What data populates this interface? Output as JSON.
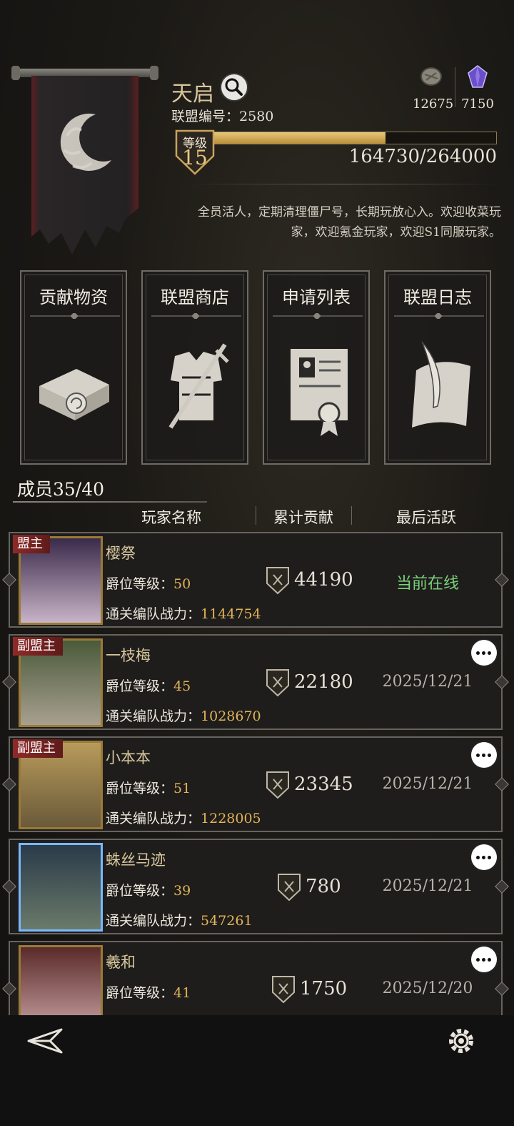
{
  "alliance": {
    "name": "天启",
    "id_label": "联盟编号：",
    "id": "2580",
    "description": "全员活人，定期清理僵尸号，长期玩放心入。欢迎收菜玩家，欢迎氪金玩家，欢迎S1同服玩家。"
  },
  "resources": [
    {
      "icon": "stone-coin-icon",
      "value": "12675"
    },
    {
      "icon": "purple-crystal-icon",
      "value": "7150"
    }
  ],
  "level": {
    "label": "等级",
    "value": "15",
    "xp_text": "164730/264000",
    "progress": 0.624
  },
  "features": [
    {
      "label": "贡献物资",
      "icon": "scroll-bundle-icon"
    },
    {
      "label": "联盟商店",
      "icon": "armor-sword-icon"
    },
    {
      "label": "申请列表",
      "icon": "certificate-icon"
    },
    {
      "label": "联盟日志",
      "icon": "quill-paper-icon"
    }
  ],
  "members": {
    "count_label": "成员35/40",
    "columns": [
      "玩家名称",
      "累计贡献",
      "最后活跃"
    ],
    "rank_label": "爵位等级：",
    "power_label": "通关编队战力：",
    "rows": [
      {
        "role": "盟主",
        "name": "樱祭",
        "rank": "50",
        "power": "1144754",
        "contribution": "44190",
        "last_active": "当前在线",
        "online": true
      },
      {
        "role": "副盟主",
        "name": "一枝梅",
        "rank": "45",
        "power": "1028670",
        "contribution": "22180",
        "last_active": "2025/12/21",
        "online": false
      },
      {
        "role": "副盟主",
        "name": "小本本",
        "rank": "51",
        "power": "1228005",
        "contribution": "23345",
        "last_active": "2025/12/21",
        "online": false
      },
      {
        "role": "",
        "name": "蛛丝马迹",
        "rank": "39",
        "power": "547261",
        "contribution": "780",
        "last_active": "2025/12/21",
        "online": false
      },
      {
        "role": "",
        "name": "羲和",
        "rank": "41",
        "power": "",
        "contribution": "1750",
        "last_active": "2025/12/20",
        "online": false
      }
    ]
  },
  "colors": {
    "gold": "#e3b357",
    "name_gold": "#d8c69c",
    "online_green": "#7ad07a",
    "role_red": "#8e2a28"
  }
}
